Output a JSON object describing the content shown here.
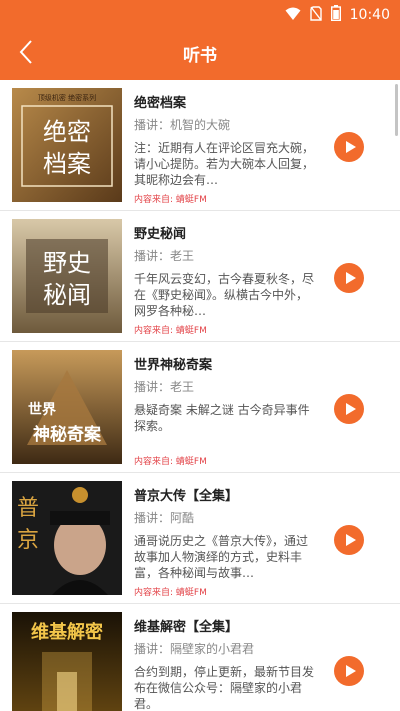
{
  "status": {
    "time": "10:40"
  },
  "header": {
    "title": "听书"
  },
  "items": [
    {
      "title": "绝密档案",
      "anchor": "播讲：机智的大碗",
      "desc": "注：近期有人在评论区冒充大碗，请小心提防。若为大碗本人回复，其昵称边会有…",
      "source": "内容来自: 蜻蜓FM",
      "cover_text": "绝密档案",
      "cover_small": "顶级机密 绝密系列"
    },
    {
      "title": "野史秘闻",
      "anchor": "播讲：老王",
      "desc": "千年风云变幻，古今春夏秋冬，尽在《野史秘闻》。纵横古今中外，网罗各种秘…",
      "source": "内容来自: 蜻蜓FM",
      "cover_text": "野史秘闻"
    },
    {
      "title": "世界神秘奇案",
      "anchor": "播讲：老王",
      "desc": "悬疑奇案  未解之谜  古今奇异事件探索。",
      "source": "内容来自: 蜻蜓FM",
      "cover_text": "世界神秘奇案"
    },
    {
      "title": "普京大传【全集】",
      "anchor": "播讲：阿酷",
      "desc": "通哥说历史之《普京大传》，通过故事加人物演绎的方式，史料丰富，各种秘闻与故事…",
      "source": "内容来自: 蜻蜓FM",
      "cover_text": "普京"
    },
    {
      "title": "维基解密【全集】",
      "anchor": "播讲：隔壁家的小君君",
      "desc": "合约到期，停止更新，最新节目发布在微信公众号：隔壁家的小君君。",
      "source": "",
      "cover_text": "维基解密"
    }
  ],
  "colors": {
    "accent": "#f26b2c",
    "source_red": "#e3454a"
  },
  "icons": [
    "wifi-icon",
    "no-sim-icon",
    "battery-icon",
    "back-arrow-icon",
    "play-icon"
  ]
}
